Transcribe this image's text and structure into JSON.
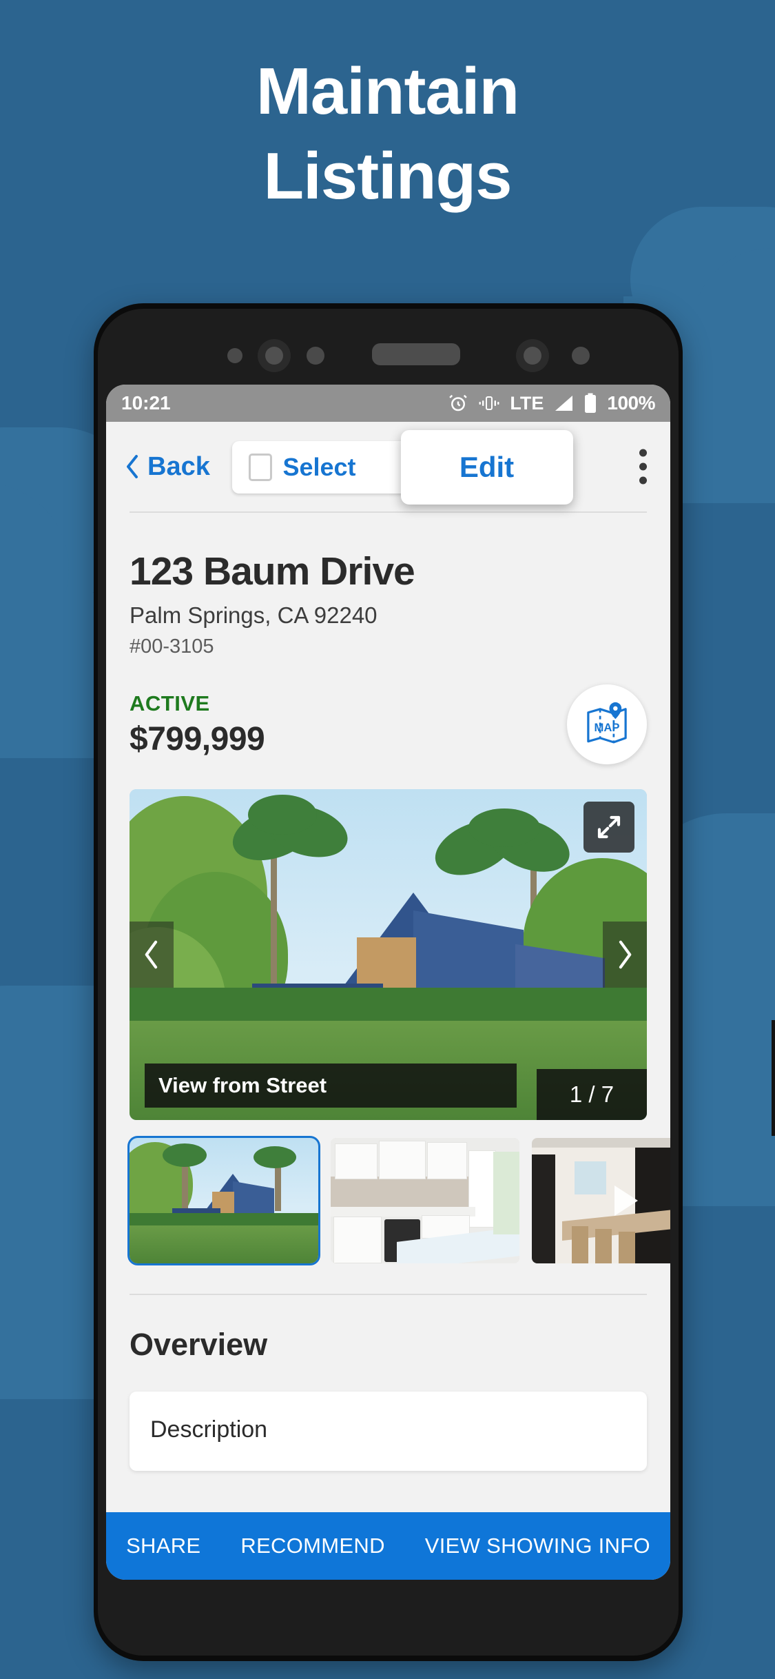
{
  "headline": {
    "line1": "Maintain",
    "line2": "Listings"
  },
  "theme": {
    "background": "#2c648f",
    "cloud": "#34719d",
    "accent_blue": "#1775d1",
    "bottom_bar_blue": "#0f76d8",
    "active_green": "#1e7a1e",
    "screen_bg": "#f2f2f2",
    "statusbar_gray": "#919191"
  },
  "statusbar": {
    "time": "10:21",
    "battery_percent": "100%",
    "network": "LTE",
    "icons": [
      "alarm-clock-icon",
      "vibrate-icon",
      "lte-label",
      "signal-bars-icon",
      "battery-icon"
    ]
  },
  "navbar": {
    "back_label": "Back",
    "back_icon": "chevron-left-icon",
    "select_label": "Select",
    "select_checked": false,
    "edit_label": "Edit",
    "overflow_icon": "kebab-menu-icon"
  },
  "listing": {
    "address_line1": "123 Baum Drive",
    "address_line2": "Palm Springs, CA 92240",
    "listing_id": "#00-3105",
    "status": "ACTIVE",
    "price": "$799,999",
    "map_button_label": "MAP",
    "map_button_icon": "map-pin-icon"
  },
  "carousel": {
    "caption": "View from Street",
    "counter": "1 / 7",
    "current_index": 1,
    "total": 7,
    "expand_icon": "expand-arrows-icon",
    "prev_icon": "chevron-left-icon",
    "next_icon": "chevron-right-icon",
    "hero_alt": "Modern blue gabled house with palm trees and lawn"
  },
  "thumbnails": [
    {
      "name": "thumbnail-exterior",
      "alt": "House exterior with lawn",
      "selected": true,
      "is_video": false
    },
    {
      "name": "thumbnail-kitchen",
      "alt": "White modern kitchen",
      "selected": false,
      "is_video": false
    },
    {
      "name": "thumbnail-dining-video",
      "alt": "Dining room video",
      "selected": false,
      "is_video": true
    }
  ],
  "overview": {
    "heading": "Overview",
    "description_label": "Description"
  },
  "bottombar": {
    "share_label": "SHARE",
    "recommend_label": "RECOMMEND",
    "showing_label": "VIEW SHOWING INFO"
  }
}
